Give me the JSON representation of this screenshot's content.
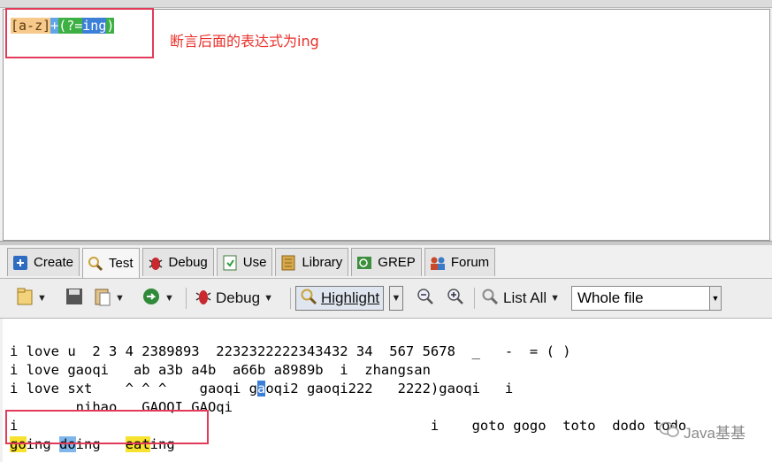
{
  "regex": {
    "tokens": [
      {
        "text": "[a-z]",
        "kind": "class"
      },
      {
        "text": "+",
        "kind": "plus"
      },
      {
        "text": "(?=",
        "kind": "look"
      },
      {
        "text": "ing",
        "kind": "lit"
      },
      {
        "text": ")",
        "kind": "look"
      }
    ],
    "note": "断言后面的表达式为ing"
  },
  "tabs": [
    {
      "label": "Create",
      "icon": "create-icon",
      "active": false
    },
    {
      "label": "Test",
      "icon": "magnifier-icon",
      "active": true
    },
    {
      "label": "Debug",
      "icon": "bug-icon",
      "active": false
    },
    {
      "label": "Use",
      "icon": "use-icon",
      "active": false
    },
    {
      "label": "Library",
      "icon": "library-icon",
      "active": false
    },
    {
      "label": "GREP",
      "icon": "grep-icon",
      "active": false
    },
    {
      "label": "Forum",
      "icon": "forum-icon",
      "active": false
    }
  ],
  "toolbar": {
    "debug_label": "Debug",
    "highlight_label": "Highlight",
    "list_all_label": "List All",
    "scope_value": "Whole file"
  },
  "test_lines": [
    "i love u  2 3 4 2389893  2232322222343432 34  567 5678  _   -  = ( )",
    "i love gaoqi   ab a3b a4b  a66b a8989b  i  zhangsan",
    "i love sxt    ^ ^ ^    gaoqi gaoqi2 gaoqi222   2222)gaoqi   i",
    "        nihao   GAOQI GAOqi",
    "i                                                  i    goto gogo  toto  dodo todo"
  ],
  "match_line": [
    {
      "text": "go",
      "match": "yellow"
    },
    {
      "text": "ing ",
      "match": ""
    },
    {
      "text": "do",
      "match": "blue"
    },
    {
      "text": "ing   ",
      "match": ""
    },
    {
      "text": "eat",
      "match": "yellow"
    },
    {
      "text": "ing",
      "match": ""
    }
  ],
  "watermark": "Java基基"
}
